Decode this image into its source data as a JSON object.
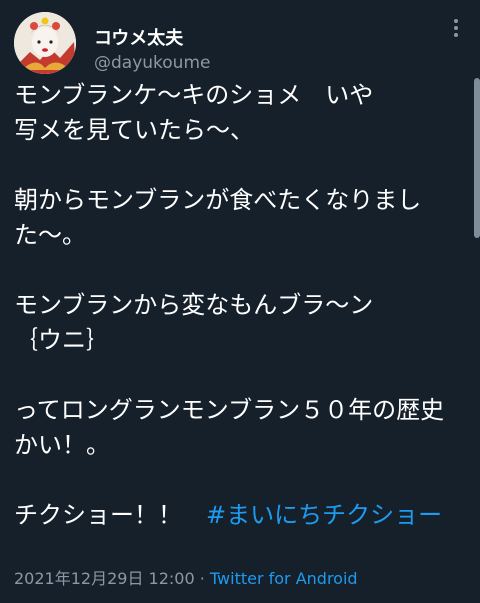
{
  "user": {
    "display_name": "コウメ太夫",
    "handle": "@dayukoume",
    "avatar_icon": "avatar-photo"
  },
  "more_icon": "more-vertical-icon",
  "tweet": {
    "text": "モンブランケ〜キのショメ　いや\n写メを見ていたら〜、\n\n朝からモンブランが食べたくなりました〜。\n\nモンブランから変なもんブラ〜ン\n｛ウニ｝\n\nってロングランモンブラン５０年の歴史かい！。\n\nチクショー！！　",
    "hashtag": "#まいにちチクショー"
  },
  "meta": {
    "timestamp": "2021年12月29日 12:00",
    "separator": " · ",
    "source": "Twitter for Android"
  },
  "colors": {
    "background": "#15202b",
    "text": "#ffffff",
    "secondary": "#8b98a5",
    "link": "#1d9bf0"
  }
}
